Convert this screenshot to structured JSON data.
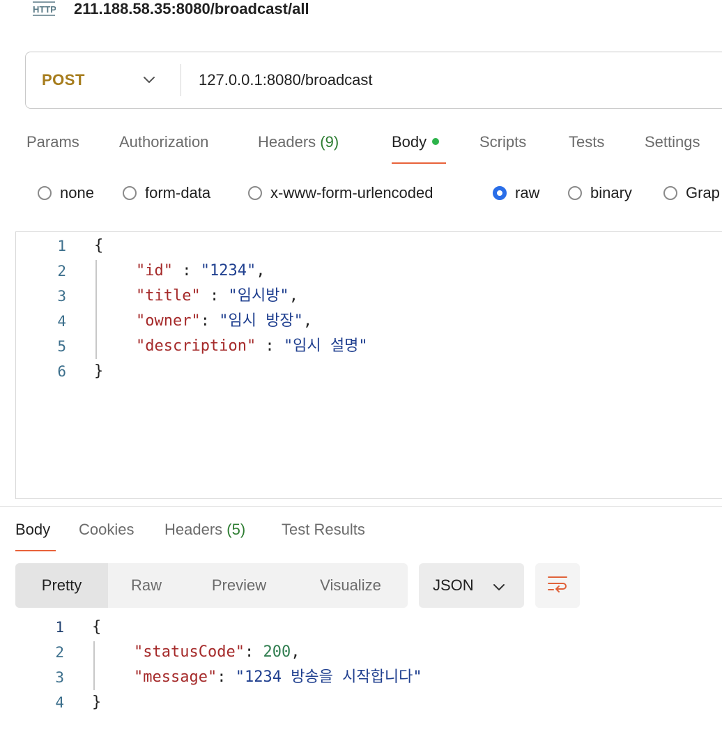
{
  "request": {
    "name": "211.188.58.35:8080/broadcast/all",
    "method": "POST",
    "url": "127.0.0.1:8080/broadcast"
  },
  "request_tabs": {
    "params": "Params",
    "authorization": "Authorization",
    "headers": "Headers",
    "headers_count": "(9)",
    "body": "Body",
    "scripts": "Scripts",
    "tests": "Tests",
    "settings": "Settings"
  },
  "body_types": {
    "none": "none",
    "form_data": "form-data",
    "urlencoded": "x-www-form-urlencoded",
    "raw": "raw",
    "binary": "binary",
    "graphql": "Grap",
    "selected": "raw"
  },
  "request_body": {
    "line_numbers": [
      "1",
      "2",
      "3",
      "4",
      "5",
      "6"
    ],
    "open_brace": "{",
    "close_brace": "}",
    "fields": [
      {
        "key": "\"id\"",
        "sep": " : ",
        "value": "\"1234\"",
        "trail": ","
      },
      {
        "key": "\"title\"",
        "sep": " : ",
        "value": "\"임시방\"",
        "trail": ","
      },
      {
        "key": "\"owner\"",
        "sep": ": ",
        "value": "\"임시 방장\"",
        "trail": ","
      },
      {
        "key": "\"description\"",
        "sep": " : ",
        "value": "\"임시 설명\"",
        "trail": ""
      }
    ]
  },
  "response_tabs": {
    "body": "Body",
    "cookies": "Cookies",
    "headers": "Headers",
    "headers_count": "(5)",
    "test_results": "Test Results"
  },
  "response_view": {
    "pretty": "Pretty",
    "raw": "Raw",
    "preview": "Preview",
    "visualize": "Visualize",
    "format": "JSON"
  },
  "response_body": {
    "line_numbers": [
      "1",
      "2",
      "3",
      "4"
    ],
    "open_brace": "{",
    "close_brace": "}",
    "status_key": "\"statusCode\"",
    "status_sep": ": ",
    "status_value": "200",
    "status_trail": ",",
    "message_key": "\"message\"",
    "message_sep": ": ",
    "message_value": "\"1234 방송을 시작합니다\""
  },
  "colors": {
    "accent_tab": "#e8623a",
    "method_post": "#a67c1c",
    "radio_selected": "#2a6ee8",
    "count_green": "#2e7d32"
  }
}
